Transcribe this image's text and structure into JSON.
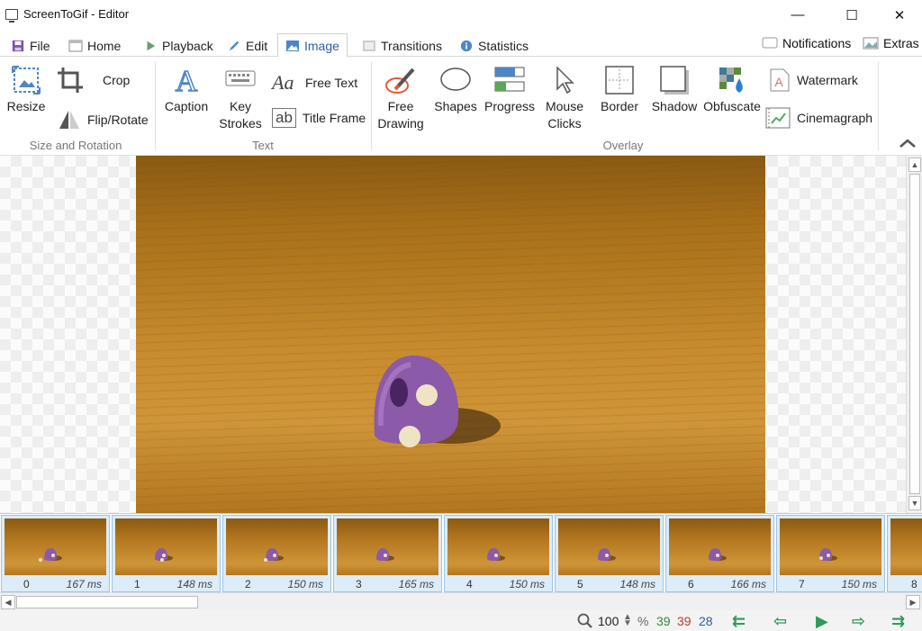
{
  "window": {
    "title": "ScreenToGif - Editor",
    "minimize": "—",
    "maximize": "☐",
    "close": "✕"
  },
  "tabs": [
    {
      "label": "File"
    },
    {
      "label": "Home"
    },
    {
      "label": "Playback"
    },
    {
      "label": "Edit"
    },
    {
      "label": "Image"
    },
    {
      "label": "Transitions"
    },
    {
      "label": "Statistics"
    }
  ],
  "active_tab": "Image",
  "header_right": {
    "notifications": "Notifications",
    "extras": "Extras"
  },
  "ribbon": {
    "size_rotation": {
      "resize": "Resize",
      "crop": "Crop",
      "flip_rotate": "Flip/Rotate",
      "group": "Size and Rotation"
    },
    "text": {
      "caption": "Caption",
      "key_strokes_1": "Key",
      "key_strokes_2": "Strokes",
      "free_text": "Free Text",
      "title_frame": "Title Frame",
      "group": "Text"
    },
    "overlay": {
      "free_drawing_1": "Free",
      "free_drawing_2": "Drawing",
      "shapes": "Shapes",
      "progress": "Progress",
      "mouse_clicks_1": "Mouse",
      "mouse_clicks_2": "Clicks",
      "border": "Border",
      "shadow": "Shadow",
      "obfuscate": "Obfuscate",
      "watermark": "Watermark",
      "cinemagraph": "Cinemagraph",
      "group": "Overlay"
    },
    "icon_labels": {
      "free_text_glyph": "Aa",
      "title_frame_glyph": "ab",
      "caption_glyph": "A"
    }
  },
  "frames": [
    {
      "index": "0",
      "duration": "167 ms"
    },
    {
      "index": "1",
      "duration": "148 ms"
    },
    {
      "index": "2",
      "duration": "150 ms"
    },
    {
      "index": "3",
      "duration": "165 ms"
    },
    {
      "index": "4",
      "duration": "150 ms"
    },
    {
      "index": "5",
      "duration": "148 ms"
    },
    {
      "index": "6",
      "duration": "166 ms"
    },
    {
      "index": "7",
      "duration": "150 ms"
    },
    {
      "index": "8",
      "duration": ""
    }
  ],
  "status": {
    "zoom": "100",
    "zoom_unit": "%",
    "frame_count": "39",
    "selected_count": "39",
    "current_frame": "28",
    "colors": {
      "count": "#2e8b3a",
      "selected": "#c0392b",
      "current": "#2a5ea8"
    }
  },
  "colors": {
    "accent": "#2a5ea8",
    "nav_green": "#2e9a5a"
  }
}
